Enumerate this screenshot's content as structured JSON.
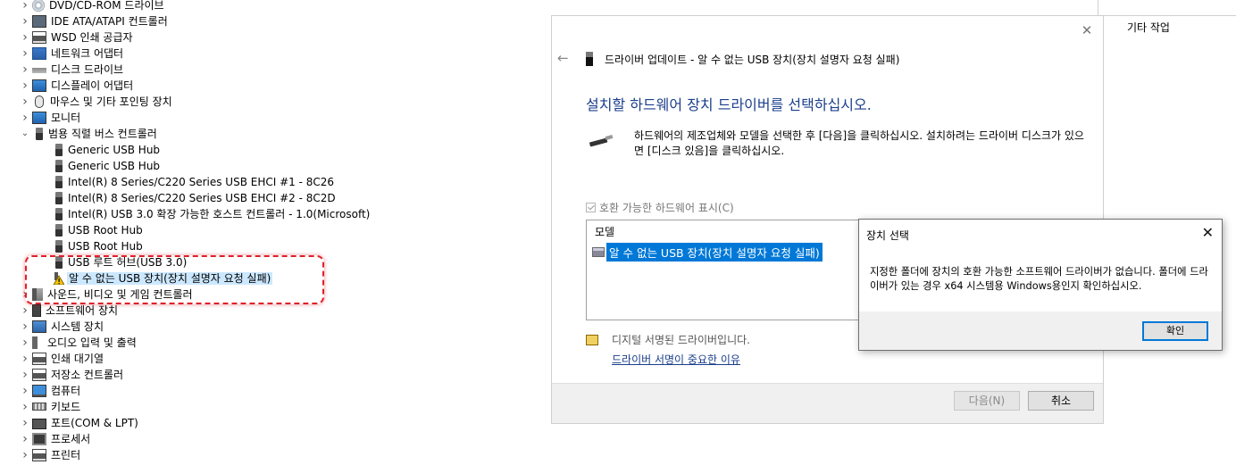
{
  "tree": {
    "items": [
      {
        "label": "DVD/CD-ROM 드라이브",
        "icon": "dvd-icon",
        "level": 0,
        "expanded": false
      },
      {
        "label": "IDE ATA/ATAPI 컨트롤러",
        "icon": "ide-controller-icon",
        "level": 0,
        "expanded": false
      },
      {
        "label": "WSD 인쇄 공급자",
        "icon": "printer-icon",
        "level": 0,
        "expanded": false
      },
      {
        "label": "네트워크 어댑터",
        "icon": "network-adapter-icon",
        "level": 0,
        "expanded": false
      },
      {
        "label": "디스크 드라이브",
        "icon": "disk-drive-icon",
        "level": 0,
        "expanded": false
      },
      {
        "label": "디스플레이 어댑터",
        "icon": "display-adapter-icon",
        "level": 0,
        "expanded": false
      },
      {
        "label": "마우스 및 기타 포인팅 장치",
        "icon": "mouse-icon",
        "level": 0,
        "expanded": false
      },
      {
        "label": "모니터",
        "icon": "monitor-icon",
        "level": 0,
        "expanded": false
      },
      {
        "label": "범용 직렬 버스 컨트롤러",
        "icon": "usb-icon",
        "level": 0,
        "expanded": true
      },
      {
        "label": "Generic USB Hub",
        "icon": "usb-icon",
        "level": 1
      },
      {
        "label": "Generic USB Hub",
        "icon": "usb-icon",
        "level": 1
      },
      {
        "label": "Intel(R) 8 Series/C220 Series USB EHCI #1 - 8C26",
        "icon": "usb-icon",
        "level": 1
      },
      {
        "label": "Intel(R) 8 Series/C220 Series USB EHCI #2 - 8C2D",
        "icon": "usb-icon",
        "level": 1
      },
      {
        "label": "Intel(R) USB 3.0 확장 가능한 호스트 컨트롤러 - 1.0(Microsoft)",
        "icon": "usb-icon",
        "level": 1
      },
      {
        "label": "USB Root Hub",
        "icon": "usb-icon",
        "level": 1
      },
      {
        "label": "USB Root Hub",
        "icon": "usb-icon",
        "level": 1
      },
      {
        "label": "USB 루트 허브(USB 3.0)",
        "icon": "usb-icon",
        "level": 1
      },
      {
        "label": "알 수 없는 USB 장치(장치 설명자 요청 실패)",
        "icon": "warning-icon",
        "level": 1,
        "selected": true
      },
      {
        "label": "사운드, 비디오 및 게임 컨트롤러",
        "icon": "sound-icon",
        "level": 0,
        "expanded": false
      },
      {
        "label": "소프트웨어 장치",
        "icon": "software-device-icon",
        "level": 0,
        "expanded": false
      },
      {
        "label": "시스템 장치",
        "icon": "system-device-icon",
        "level": 0,
        "expanded": false
      },
      {
        "label": "오디오 입력 및 출력",
        "icon": "speaker-icon",
        "level": 0,
        "expanded": false
      },
      {
        "label": "인쇄 대기열",
        "icon": "printer-icon",
        "level": 0,
        "expanded": false
      },
      {
        "label": "저장소 컨트롤러",
        "icon": "storage-controller-icon",
        "level": 0,
        "expanded": false
      },
      {
        "label": "컴퓨터",
        "icon": "computer-icon",
        "level": 0,
        "expanded": false
      },
      {
        "label": "키보드",
        "icon": "keyboard-icon",
        "level": 0,
        "expanded": false
      },
      {
        "label": "포트(COM & LPT)",
        "icon": "port-icon",
        "level": 0,
        "expanded": false
      },
      {
        "label": "프로세서",
        "icon": "processor-icon",
        "level": 0,
        "expanded": false
      },
      {
        "label": "프린터",
        "icon": "printer-icon",
        "level": 0,
        "expanded": false
      }
    ]
  },
  "wizard": {
    "title": "드라이버 업데이트 - 알 수 없는 USB 장치(장치 설명자 요청 실패)",
    "heading": "설치할 하드웨어 장치 드라이버를 선택하십시오.",
    "description": "하드웨어의 제조업체와 모델을 선택한 후 [다음]을 클릭하십시오. 설치하려는 드라이버 디스크가 있으면 [디스크 있음]을 클릭하십시오.",
    "compatible_label": "호환 가능한 하드웨어 표시(C)",
    "compatible_checked": true,
    "model_header": "모델",
    "model_items": [
      "알 수 없는 USB 장치(장치 설명자 요청 실패)"
    ],
    "signed_text": "디지털 서명된 드라이버입니다.",
    "why_link": "드라이버 서명이 중요한 이유",
    "next_button": "다음(N)",
    "cancel_button": "취소"
  },
  "msgbox": {
    "title": "장치 선택",
    "message": "지정한 폴더에 장치의 호환 가능한 소프트웨어 드라이버가 없습니다. 폴더에 드라이버가 있는 경우 x64 시스템용 Windows용인지 확인하십시오.",
    "ok_button": "확인"
  },
  "actions": {
    "label": "기타 작업"
  }
}
